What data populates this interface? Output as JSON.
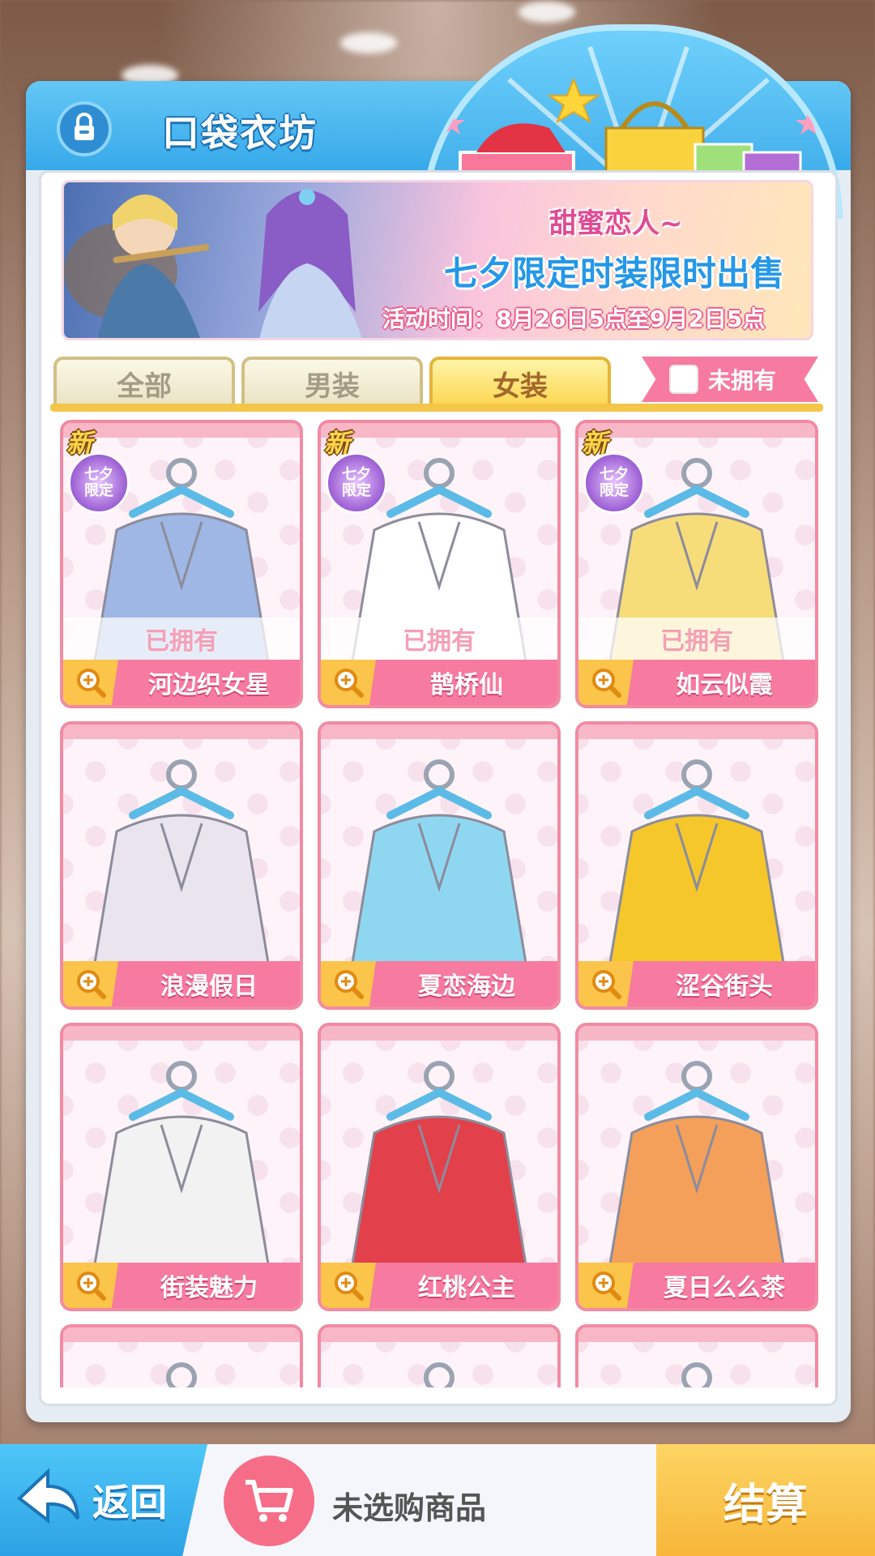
{
  "header": {
    "title": "口袋衣坊",
    "lock_icon": "lock-icon"
  },
  "banner": {
    "subtitle": "甜蜜恋人~",
    "headline": "七夕限定时装限时出售",
    "time_text": "活动时间：8月26日5点至9月2日5点"
  },
  "tabs": [
    {
      "label": "全部",
      "active": false
    },
    {
      "label": "男装",
      "active": false
    },
    {
      "label": "女装",
      "active": true
    }
  ],
  "filter": {
    "unowned_label": "未拥有",
    "checked": false
  },
  "badges": {
    "new_label": "新",
    "limited_label": "七夕\n限定",
    "owned_label": "已拥有"
  },
  "items": [
    {
      "name": "河边织女星",
      "is_new": true,
      "limited": true,
      "owned": true,
      "color": "#9fb7e4"
    },
    {
      "name": "鹊桥仙",
      "is_new": true,
      "limited": true,
      "owned": true,
      "color": "#ffffff"
    },
    {
      "name": "如云似霞",
      "is_new": true,
      "limited": true,
      "owned": true,
      "color": "#f7dc7a"
    },
    {
      "name": "浪漫假日",
      "is_new": false,
      "limited": false,
      "owned": false,
      "color": "#e9e4ee"
    },
    {
      "name": "夏恋海边",
      "is_new": false,
      "limited": false,
      "owned": false,
      "color": "#8fd7f0"
    },
    {
      "name": "涩谷街头",
      "is_new": false,
      "limited": false,
      "owned": false,
      "color": "#f5c72b"
    },
    {
      "name": "街装魅力",
      "is_new": false,
      "limited": false,
      "owned": false,
      "color": "#f2f2f2"
    },
    {
      "name": "红桃公主",
      "is_new": false,
      "limited": false,
      "owned": false,
      "color": "#e2404a"
    },
    {
      "name": "夏日么么茶",
      "is_new": false,
      "limited": false,
      "owned": false,
      "color": "#f4a05a"
    },
    {
      "name": "",
      "is_new": false,
      "limited": false,
      "owned": false,
      "color": "#f2f2f2"
    },
    {
      "name": "",
      "is_new": false,
      "limited": false,
      "owned": false,
      "color": "#f2f2f2"
    },
    {
      "name": "",
      "is_new": false,
      "limited": false,
      "owned": false,
      "color": "#f2f2f2"
    }
  ],
  "bottom": {
    "back_label": "返回",
    "cart_text": "未选购商品",
    "checkout_label": "结算"
  }
}
